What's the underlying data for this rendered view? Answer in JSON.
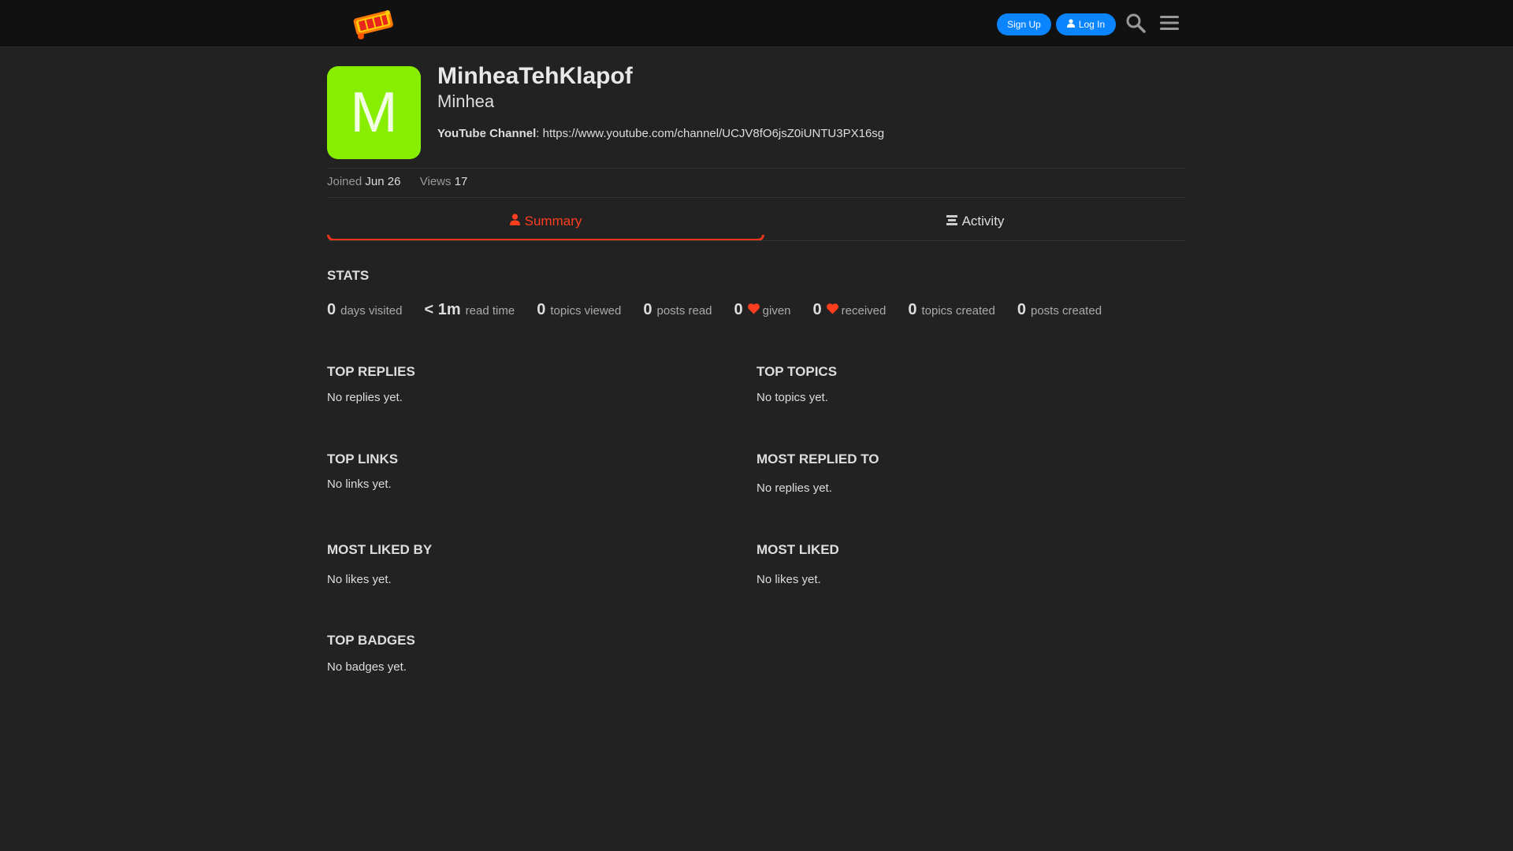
{
  "header": {
    "signup_label": "Sign Up",
    "login_label": "Log In"
  },
  "profile": {
    "avatar_letter": "M",
    "avatar_color": "#88ee00",
    "username": "MinheaTehKlapof",
    "full_name": "Minhea",
    "field_label": "YouTube Channel",
    "field_value": "https://www.youtube.com/channel/UCJV8fO6jsZ0iUNTU3PX16sg",
    "joined_label": "Joined",
    "joined_value": "Jun 26",
    "views_label": "Views",
    "views_value": "17"
  },
  "tabs": {
    "summary": "Summary",
    "activity": "Activity"
  },
  "stats": {
    "title": "Stats",
    "items": [
      {
        "value": "0",
        "label": "days visited"
      },
      {
        "value": "< 1m",
        "label": "read time"
      },
      {
        "value": "0",
        "label": "topics viewed"
      },
      {
        "value": "0",
        "label": "posts read"
      },
      {
        "value": "0",
        "label": "given"
      },
      {
        "value": "0",
        "label": "received"
      },
      {
        "value": "0",
        "label": "topics created"
      },
      {
        "value": "0",
        "label": "posts created"
      }
    ]
  },
  "sections": {
    "top_replies": {
      "title": "Top Replies",
      "empty": "No replies yet."
    },
    "top_topics": {
      "title": "Top Topics",
      "empty": "No topics yet."
    },
    "top_links": {
      "title": "Top Links",
      "empty": "No links yet."
    },
    "most_replied_to": {
      "title": "Most Replied To",
      "empty": "No replies yet."
    },
    "most_liked_by": {
      "title": "Most Liked By",
      "empty": "No likes yet."
    },
    "most_liked": {
      "title": "Most Liked",
      "empty": "No likes yet."
    },
    "top_badges": {
      "title": "Top Badges",
      "empty": "No badges yet."
    }
  },
  "colors": {
    "accent": "#e8361d",
    "button_blue": "#0a84ff",
    "heart": "#ff3d1f"
  }
}
